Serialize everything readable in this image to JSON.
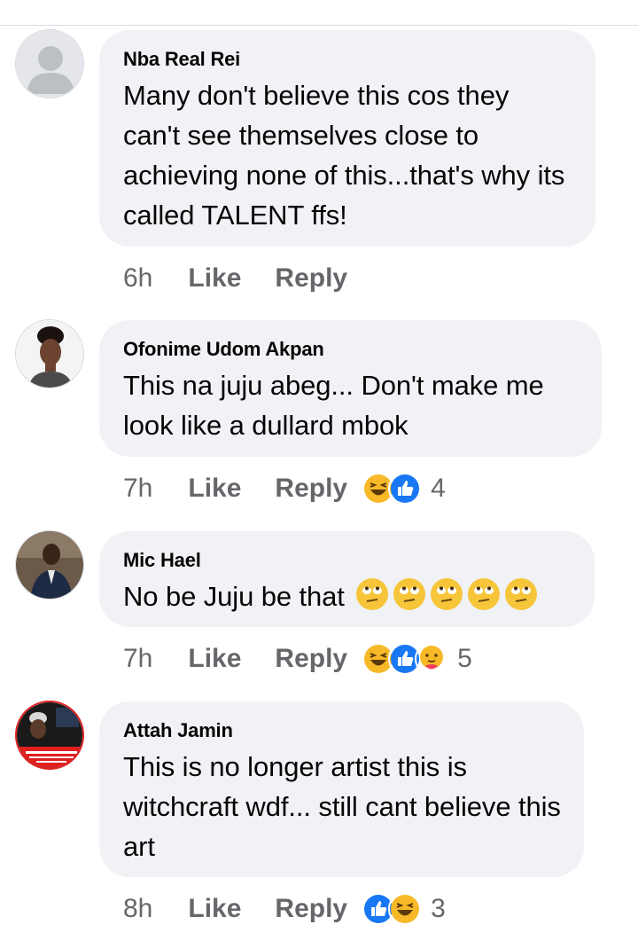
{
  "comments": [
    {
      "author": "Nba Real Rei",
      "text": "Many don't believe this cos they can't see themselves close to achieving none of this...that's why its called TALENT ffs!",
      "time": "6h",
      "like": "Like",
      "reply": "Reply",
      "reactions": [],
      "reaction_count": ""
    },
    {
      "author": "Ofonime Udom Akpan",
      "text": "This na juju abeg... Don't make me look like a dullard mbok",
      "time": "7h",
      "like": "Like",
      "reply": "Reply",
      "reactions": [
        "haha-icon",
        "like-icon"
      ],
      "reaction_count": "4"
    },
    {
      "author": "Mic Hael",
      "text": "No be Juju be that",
      "text_emojis": [
        "eye-roll-emoji",
        "eye-roll-emoji",
        "eye-roll-emoji",
        "eye-roll-emoji",
        "eye-roll-emoji"
      ],
      "time": "7h",
      "like": "Like",
      "reply": "Reply",
      "reactions": [
        "haha-icon",
        "like-icon",
        "care-icon"
      ],
      "reaction_count": "5"
    },
    {
      "author": "Attah Jamin",
      "text": "This is no longer artist this is witchcraft wdf... still cant believe this art",
      "time": "8h",
      "like": "Like",
      "reply": "Reply",
      "reactions": [
        "like-icon",
        "haha-icon"
      ],
      "reaction_count": "3"
    }
  ],
  "colors": {
    "bubble": "#f0f2f5",
    "meta_text": "#65676b",
    "like_blue": "#1877f2",
    "haha_yellow": "#f7b928"
  }
}
